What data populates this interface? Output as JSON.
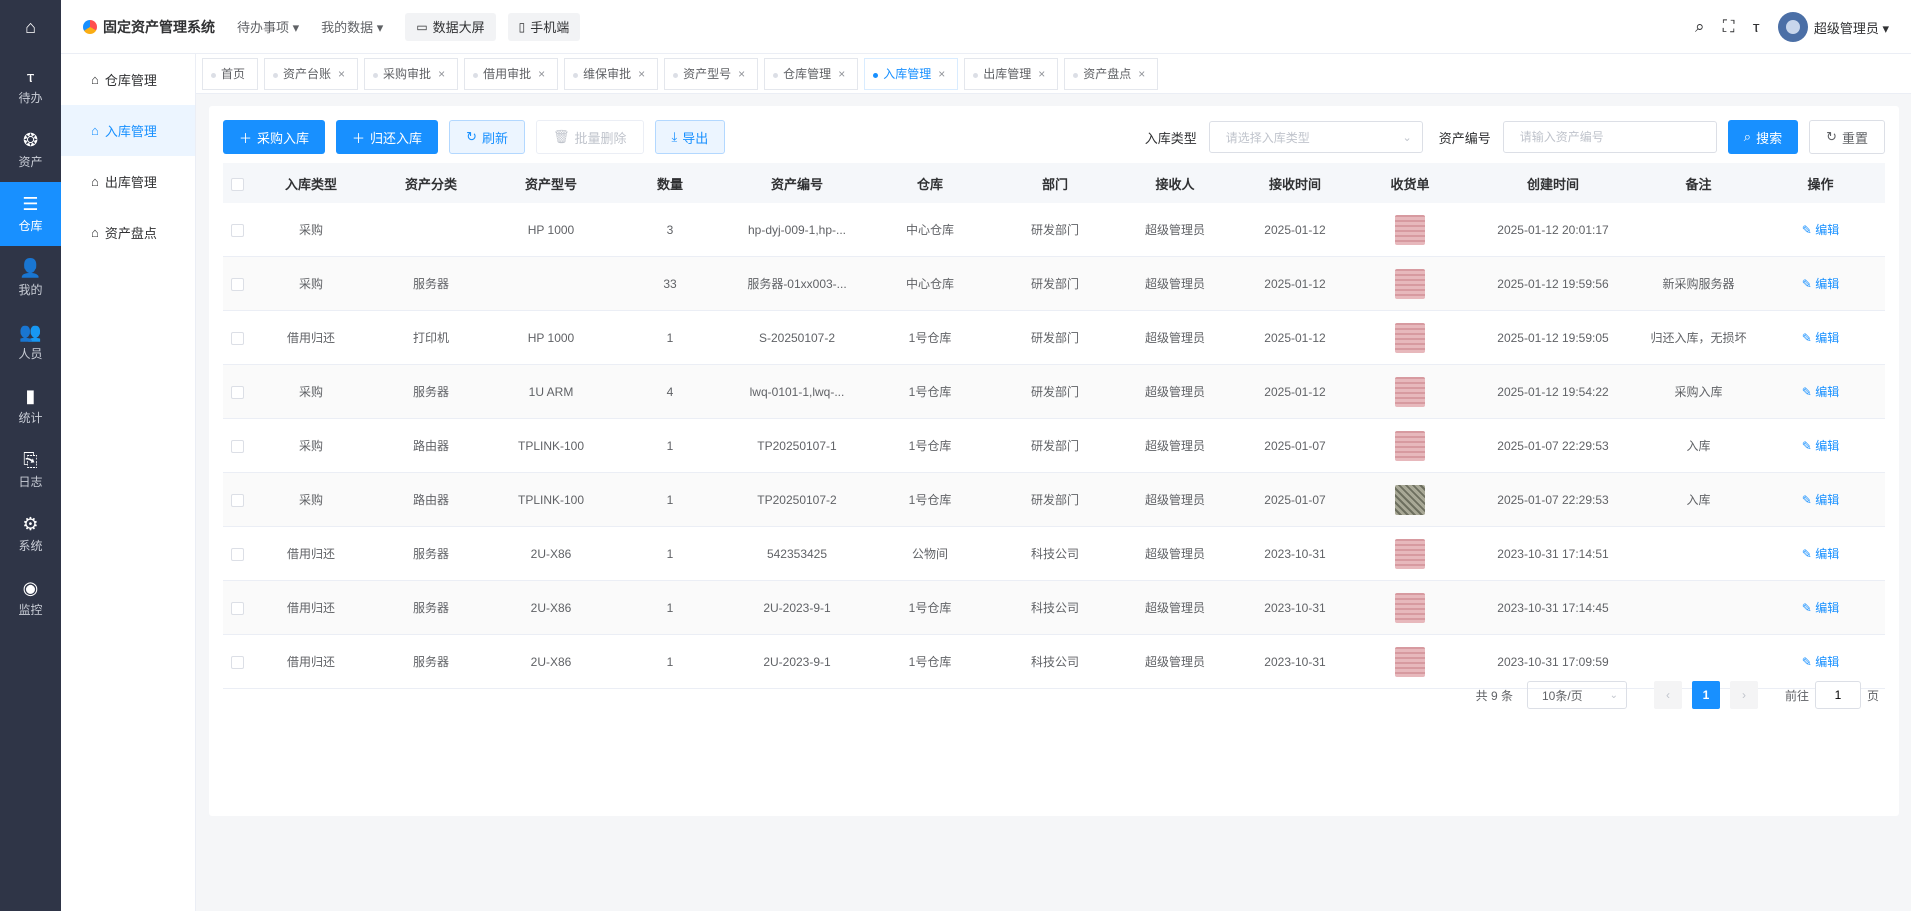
{
  "rail": {
    "home_icon": "home-icon",
    "items": [
      {
        "label": "待办",
        "icon": "todo-icon",
        "glyph": "ⲧ"
      },
      {
        "label": "资产",
        "icon": "asset-icon",
        "glyph": "❂"
      },
      {
        "label": "仓库",
        "icon": "warehouse-icon",
        "glyph": "☰"
      },
      {
        "label": "我的",
        "icon": "user-icon",
        "glyph": "👤"
      },
      {
        "label": "人员",
        "icon": "people-icon",
        "glyph": "👥"
      },
      {
        "label": "统计",
        "icon": "chart-icon",
        "glyph": "▮"
      },
      {
        "label": "日志",
        "icon": "log-icon",
        "glyph": "⎘"
      },
      {
        "label": "系统",
        "icon": "gear-icon",
        "glyph": "⚙"
      },
      {
        "label": "监控",
        "icon": "monitor-icon",
        "glyph": "◉"
      }
    ]
  },
  "header": {
    "title": "固定资产管理系统",
    "menu1": "待办事项",
    "menu2": "我的数据",
    "btn1": "数据大屏",
    "btn2": "手机端",
    "username": "超级管理员"
  },
  "subnav": {
    "items": [
      "仓库管理",
      "入库管理",
      "出库管理",
      "资产盘点"
    ]
  },
  "tabs": [
    "首页",
    "资产台账",
    "采购审批",
    "借用审批",
    "维保审批",
    "资产型号",
    "仓库管理",
    "入库管理",
    "出库管理",
    "资产盘点"
  ],
  "toolbar": {
    "btn_purchase": "采购入库",
    "btn_return": "归还入库",
    "btn_refresh": "刷新",
    "btn_batch_delete": "批量删除",
    "btn_export": "导出",
    "filter_type_label": "入库类型",
    "filter_type_placeholder": "请选择入库类型",
    "filter_code_label": "资产编号",
    "filter_code_placeholder": "请输入资产编号",
    "btn_search": "搜索",
    "btn_reset": "重置"
  },
  "table": {
    "columns": [
      "入库类型",
      "资产分类",
      "资产型号",
      "数量",
      "资产编号",
      "仓库",
      "部门",
      "接收人",
      "接收时间",
      "收货单",
      "创建时间",
      "备注",
      "操作"
    ],
    "edit_label": "编辑",
    "rows": [
      {
        "type": "采购",
        "category": "",
        "model": "HP 1000",
        "qty": "3",
        "code": "hp-dyj-009-1,hp-...",
        "warehouse": "中心仓库",
        "dept": "研发部门",
        "receiver": "超级管理员",
        "recv_time": "2025-01-12",
        "receipt": "receipt-thumbnail",
        "created": "2025-01-12 20:01:17",
        "remark": ""
      },
      {
        "type": "采购",
        "category": "服务器",
        "model": "",
        "qty": "33",
        "code": "服务器-01xx003-...",
        "warehouse": "中心仓库",
        "dept": "研发部门",
        "receiver": "超级管理员",
        "recv_time": "2025-01-12",
        "receipt": "receipt-thumbnail",
        "created": "2025-01-12 19:59:56",
        "remark": "新采购服务器"
      },
      {
        "type": "借用归还",
        "category": "打印机",
        "model": "HP 1000",
        "qty": "1",
        "code": "S-20250107-2",
        "warehouse": "1号仓库",
        "dept": "研发部门",
        "receiver": "超级管理员",
        "recv_time": "2025-01-12",
        "receipt": "receipt-thumbnail",
        "created": "2025-01-12 19:59:05",
        "remark": "归还入库，无损坏"
      },
      {
        "type": "采购",
        "category": "服务器",
        "model": "1U ARM",
        "qty": "4",
        "code": "lwq-0101-1,lwq-...",
        "warehouse": "1号仓库",
        "dept": "研发部门",
        "receiver": "超级管理员",
        "recv_time": "2025-01-12",
        "receipt": "receipt-thumbnail",
        "created": "2025-01-12 19:54:22",
        "remark": "采购入库"
      },
      {
        "type": "采购",
        "category": "路由器",
        "model": "TPLINK-100",
        "qty": "1",
        "code": "TP20250107-1",
        "warehouse": "1号仓库",
        "dept": "研发部门",
        "receiver": "超级管理员",
        "recv_time": "2025-01-07",
        "receipt": "receipt-thumbnail",
        "created": "2025-01-07 22:29:53",
        "remark": "入库"
      },
      {
        "type": "采购",
        "category": "路由器",
        "model": "TPLINK-100",
        "qty": "1",
        "code": "TP20250107-2",
        "warehouse": "1号仓库",
        "dept": "研发部门",
        "receiver": "超级管理员",
        "recv_time": "2025-01-07",
        "receipt": "receipt-thumbnail-alt",
        "created": "2025-01-07 22:29:53",
        "remark": "入库"
      },
      {
        "type": "借用归还",
        "category": "服务器",
        "model": "2U-X86",
        "qty": "1",
        "code": "542353425",
        "warehouse": "公物间",
        "dept": "科技公司",
        "receiver": "超级管理员",
        "recv_time": "2023-10-31",
        "receipt": "receipt-thumbnail",
        "created": "2023-10-31 17:14:51",
        "remark": ""
      },
      {
        "type": "借用归还",
        "category": "服务器",
        "model": "2U-X86",
        "qty": "1",
        "code": "2U-2023-9-1",
        "warehouse": "1号仓库",
        "dept": "科技公司",
        "receiver": "超级管理员",
        "recv_time": "2023-10-31",
        "receipt": "receipt-thumbnail",
        "created": "2023-10-31 17:14:45",
        "remark": ""
      },
      {
        "type": "借用归还",
        "category": "服务器",
        "model": "2U-X86",
        "qty": "1",
        "code": "2U-2023-9-1",
        "warehouse": "1号仓库",
        "dept": "科技公司",
        "receiver": "超级管理员",
        "recv_time": "2023-10-31",
        "receipt": "receipt-thumbnail",
        "created": "2023-10-31 17:09:59",
        "remark": ""
      }
    ]
  },
  "pager": {
    "total": "共 9 条",
    "page_size": "10条/页",
    "current_page": "1",
    "goto_label": "前往",
    "goto_value": "1",
    "page_suffix": "页"
  },
  "colors": {
    "accent": "#1890ff",
    "rail_bg": "#2f3547"
  }
}
